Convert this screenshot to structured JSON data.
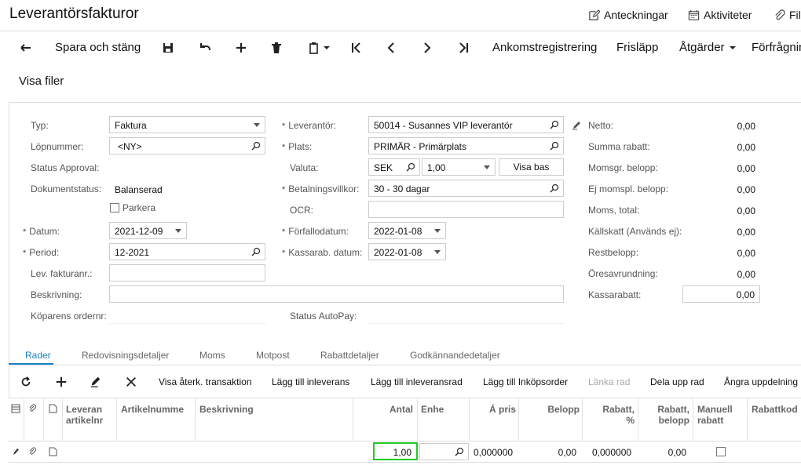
{
  "window": {
    "title": "Leverantörsfakturor"
  },
  "header_links": [
    {
      "label": "Anteckningar",
      "icon": "notes-icon"
    },
    {
      "label": "Aktiviteter",
      "icon": "calendar-icon"
    },
    {
      "label": "Fil",
      "icon": "paperclip-icon"
    }
  ],
  "toolbar": {
    "save_close": "Spara och stäng",
    "ankomst": "Ankomstregistrering",
    "frislapp": "Frisläpp",
    "atgarder": "Åtgärder",
    "forfragningar": "Förfrågnin",
    "visa_filer": "Visa filer"
  },
  "form": {
    "typ_label": "Typ:",
    "typ_value": "Faktura",
    "lopnummer_label": "Löpnummer:",
    "lopnummer_value": "<NY>",
    "status_approval_label": "Status Approval:",
    "dokumentstatus_label": "Dokumentstatus:",
    "dokumentstatus_value": "Balanserad",
    "parkera_label": "Parkera",
    "datum_label": "Datum:",
    "datum_value": "2021-12-09",
    "period_label": "Period:",
    "period_value": "12-2021",
    "lev_fakturanr_label": "Lev. fakturanr.:",
    "beskrivning_label": "Beskrivning:",
    "koparens_ordernr_label": "Köparens ordernr:",
    "leverantor_label": "Leverantör:",
    "leverantor_value": "50014 - Susannes VIP leverantör",
    "plats_label": "Plats:",
    "plats_value": "PRIMÄR - Primärplats",
    "valuta_label": "Valuta:",
    "valuta_value": "SEK",
    "kurs_value": "1,00",
    "visa_bas": "Visa bas",
    "betalningsvillkor_label": "Betalningsvillkor:",
    "betalningsvillkor_value": "30 - 30 dagar",
    "ocr_label": "OCR:",
    "forfallodatum_label": "Förfallodatum:",
    "forfallodatum_value": "2022-01-08",
    "kassarab_datum_label": "Kassarab. datum:",
    "kassarab_datum_value": "2022-01-08",
    "status_autopay_label": "Status AutoPay:"
  },
  "summary": [
    {
      "label": "Netto:",
      "value": "0,00"
    },
    {
      "label": "Summa rabatt:",
      "value": "0,00"
    },
    {
      "label": "Momsgr. belopp:",
      "value": "0,00"
    },
    {
      "label": "Ej momspl. belopp:",
      "value": "0,00"
    },
    {
      "label": "Moms, total:",
      "value": "0,00"
    },
    {
      "label": "Källskatt (Används ej):",
      "value": "0,00"
    },
    {
      "label": "Restbelopp:",
      "value": "0,00"
    },
    {
      "label": "Öresavrundning:",
      "value": "0,00"
    },
    {
      "label": "Kassarabatt:",
      "value": "0,00"
    }
  ],
  "tabs": [
    "Rader",
    "Redovisningsdetaljer",
    "Moms",
    "Motpost",
    "Rabattdetaljer",
    "Godkännandedetaljer"
  ],
  "grid_toolbar": {
    "visa_aterk": "Visa återk. transaktion",
    "lagg_inleverans": "Lägg till inleverans",
    "lagg_inleveransrad": "Lägg till inleveransrad",
    "lagg_inkopsorder": "Lägg till Inköpsorder",
    "lanka_rad": "Länka rad",
    "dela_upp": "Dela upp rad",
    "angra": "Ångra uppdelning"
  },
  "grid": {
    "headers": {
      "lev_artikel": "Leveran\nartikelnr",
      "artikelnummer": "Artikelnumme",
      "beskrivning": "Beskrivning",
      "antal": "Antal",
      "enhet": "Enhe",
      "a_pris": "Á pris",
      "belopp": "Belopp",
      "rabatt_pct": "Rabatt,\n%",
      "rabatt_belopp": "Rabatt,\nbelopp",
      "manuell_rabatt": "Manuell\nrabatt",
      "rabattkod": "Rabattkod"
    },
    "row": {
      "antal": "1,00",
      "a_pris": "0,000000",
      "belopp": "0,00",
      "rabatt_pct": "0,000000",
      "rabatt_belopp": "0,00"
    }
  }
}
